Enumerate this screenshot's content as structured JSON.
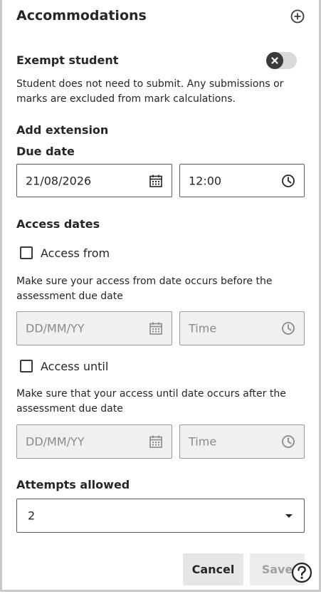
{
  "header": {
    "title": "Accommodations",
    "add_icon": "plus-circle-icon"
  },
  "exempt": {
    "label": "Exempt student",
    "toggle_state": "off",
    "description": "Student does not need to submit. Any submissions or marks are excluded from mark calculations."
  },
  "extension": {
    "heading": "Add extension",
    "due_date_label": "Due date",
    "date_value": "21/08/2026",
    "time_value": "12:00"
  },
  "access": {
    "heading": "Access dates",
    "from": {
      "label": "Access from",
      "checked": false,
      "hint": "Make sure your access from date occurs before the assessment due date",
      "date_placeholder": "DD/MM/YY",
      "time_placeholder": "Time"
    },
    "until": {
      "label": "Access until",
      "checked": false,
      "hint": "Make sure that your access until date occurs after the assessment due date",
      "date_placeholder": "DD/MM/YY",
      "time_placeholder": "Time"
    }
  },
  "attempts": {
    "label": "Attempts allowed",
    "value": "2"
  },
  "footer": {
    "cancel_label": "Cancel",
    "save_label": "Save"
  },
  "colors": {
    "text": "#262626",
    "border": "#5c5c5c",
    "disabled_bg": "#f0f0f0",
    "toggle_track": "#d9d9d9",
    "toggle_knob": "#3b3b3b"
  }
}
